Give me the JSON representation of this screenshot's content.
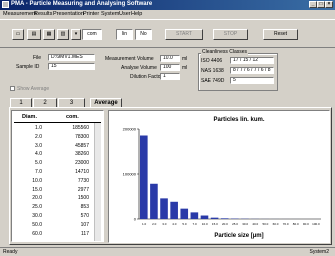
{
  "window": {
    "title": "PMA - Particle Measuring and Analysing Software"
  },
  "menu": [
    "Measurement",
    "Results",
    "Presentation",
    "Printer",
    "System",
    "User",
    "Help"
  ],
  "toolbar": {
    "unit": "com",
    "field2": "lin",
    "field3": "No",
    "start_label": "START",
    "stop_label": "STOP",
    "reset_label": "Reset"
  },
  "info": {
    "file_label": "File",
    "file_value": "D:\\9MV1.MES",
    "sample_label": "Sample ID",
    "sample_value": "15",
    "meas_volume_label": "Measurement Volume",
    "meas_volume_value": "10.0",
    "meas_volume_unit": "ml",
    "analyse_volume_label": "Analyse Volume",
    "analyse_volume_value": "100",
    "analyse_volume_unit": "ml",
    "dilution_label": "Dilution Factor",
    "dilution_value": "1",
    "cleanliness_title": "Cleanliness Classes",
    "iso_label": "ISO 4406",
    "iso_value": "17 / 15 / 12",
    "nas_label": "NAS 1638",
    "nas_value": "8 / 7 / 6 / 7 / 6 / 8",
    "sae_label": "SAE 749D",
    "sae_value": "5",
    "checkbox_label": "Show Average"
  },
  "tabs": [
    "1",
    "2",
    "3",
    "Average"
  ],
  "table": {
    "headers": [
      "Diam.",
      "com."
    ],
    "rows": [
      [
        "1.0",
        "185560"
      ],
      [
        "2.0",
        "78300"
      ],
      [
        "3.0",
        "45857"
      ],
      [
        "4.0",
        "38260"
      ],
      [
        "5.0",
        "23000"
      ],
      [
        "7.0",
        "14710"
      ],
      [
        "10.0",
        "7730"
      ],
      [
        "15.0",
        "2977"
      ],
      [
        "20.0",
        "1500"
      ],
      [
        "25.0",
        "853"
      ],
      [
        "30.0",
        "570"
      ],
      [
        "50.0",
        "107"
      ],
      [
        "60.0",
        "117"
      ]
    ]
  },
  "chart_data": {
    "type": "bar",
    "title": "Particles lin. kum.",
    "xlabel": "Particle size [µm]",
    "ylabel": "",
    "categories": [
      "1.0",
      "2.0",
      "3.0",
      "4.0",
      "5.0",
      "7.0",
      "10.0",
      "15.0",
      "20.0",
      "25.0",
      "30.0",
      "40.0",
      "50.0",
      "60.0",
      "70.0",
      "80.0",
      "90.0",
      "100.0"
    ],
    "values": [
      185560,
      78300,
      45857,
      38260,
      23000,
      14710,
      7730,
      2977,
      1500,
      853,
      570,
      300,
      150,
      117,
      80,
      50,
      30,
      20
    ],
    "yticks": [
      "200000",
      "100000",
      "0"
    ],
    "ylim": [
      0,
      200000
    ],
    "bar_color": "#2a3aa8"
  },
  "status": {
    "left": "Ready",
    "right": "System2"
  }
}
